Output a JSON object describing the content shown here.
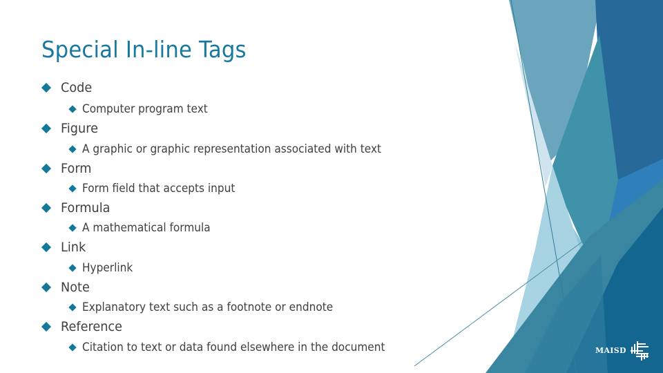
{
  "slide": {
    "title": "Special In-line Tags",
    "items": [
      {
        "label": "Code",
        "sub": "Computer program text"
      },
      {
        "label": "Figure",
        "sub": "A graphic or graphic representation associated with text"
      },
      {
        "label": "Form",
        "sub": "Form field that accepts input"
      },
      {
        "label": "Formula",
        "sub": "A mathematical formula"
      },
      {
        "label": "Link",
        "sub": "Hyperlink"
      },
      {
        "label": "Note",
        "sub": "Explanatory text such as a footnote or endnote"
      },
      {
        "label": "Reference",
        "sub": "Citation to text or data found elsewhere in the document"
      }
    ]
  },
  "logo": {
    "text": "MAISD",
    "icon": "maisd-mark-icon"
  },
  "colors": {
    "title": "#17799e",
    "bullet": "#14789b",
    "body_text": "#404040",
    "accent_dark": "#256a9a",
    "accent_teal": "#3f93a8",
    "accent_light": "#8cc6da"
  }
}
